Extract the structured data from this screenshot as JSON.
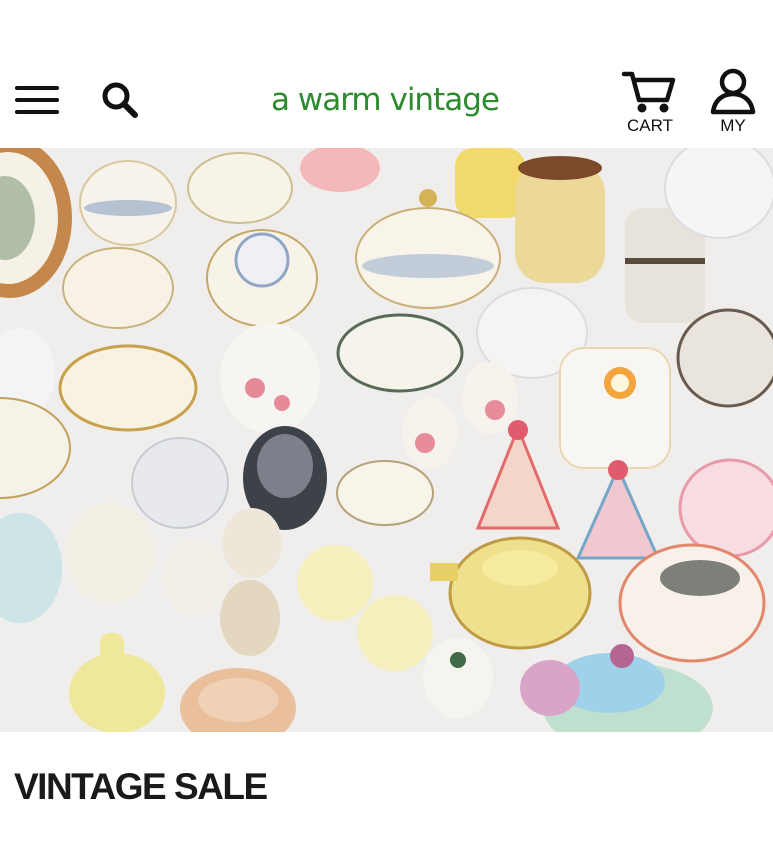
{
  "header": {
    "logo_text": "a warm vintage",
    "menu_icon": "hamburger-menu-icon",
    "search_icon": "search-icon",
    "cart": {
      "label": "CART",
      "icon": "cart-icon"
    },
    "account": {
      "label": "MY",
      "icon": "user-icon"
    },
    "brand_color": "#2d8a2d"
  },
  "hero": {
    "description": "Assorted vintage porcelain and ceramic tableware"
  },
  "section": {
    "title": "VINTAGE SALE"
  }
}
